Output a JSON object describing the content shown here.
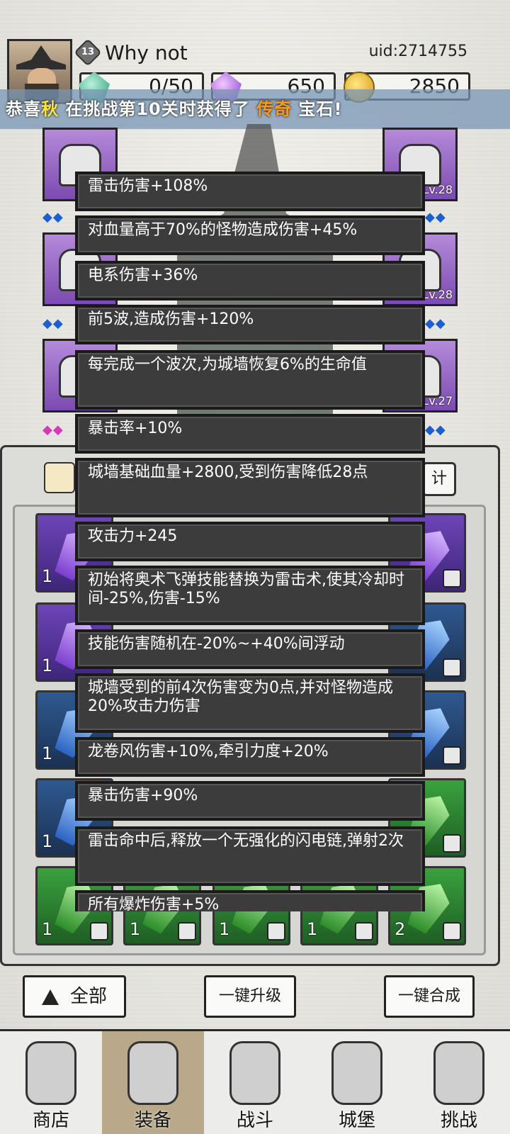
{
  "header": {
    "player_level": "13",
    "player_name": "Why not",
    "uid": "uid:2714755",
    "currency": {
      "energy": "0/50",
      "diamond": "650",
      "gold": "2850"
    }
  },
  "announcement": {
    "prefix": "恭喜",
    "player": "秋",
    "middle": "在挑战第10关时获得了",
    "rarity": "传奇",
    "suffix": "宝石!"
  },
  "equipment": {
    "slot_levels": [
      "Lv.28",
      "Lv.28",
      "Lv.27"
    ]
  },
  "inventory": {
    "stats_button": "计",
    "gem_counts": [
      "1",
      "1",
      "1",
      "1",
      "1",
      "1",
      "1",
      "1",
      "1",
      "2"
    ]
  },
  "tooltips": [
    "雷击伤害+108%",
    "对血量高于70%的怪物造成伤害+45%",
    "电系伤害+36%",
    "前5波,造成伤害+120%",
    "每完成一个波次,为城墙恢复6%的生命值",
    "暴击率+10%",
    "城墙基础血量+2800,受到伤害降低28点",
    "攻击力+245",
    "初始将奥术飞弹技能替换为雷击术,使其冷却时间-25%,伤害-15%",
    "技能伤害随机在-20%~+40%间浮动",
    "城墙受到的前4次伤害变为0点,并对怪物造成20%攻击力伤害",
    "龙卷风伤害+10%,牵引力度+20%",
    "暴击伤害+90%",
    "雷击命中后,释放一个无强化的闪电链,弹射2次",
    "所有爆炸伤害+5%"
  ],
  "buttons": {
    "all": "全部",
    "upgrade": "一键升级",
    "merge": "一键合成"
  },
  "nav": [
    "商店",
    "装备",
    "战斗",
    "城堡",
    "挑战"
  ]
}
